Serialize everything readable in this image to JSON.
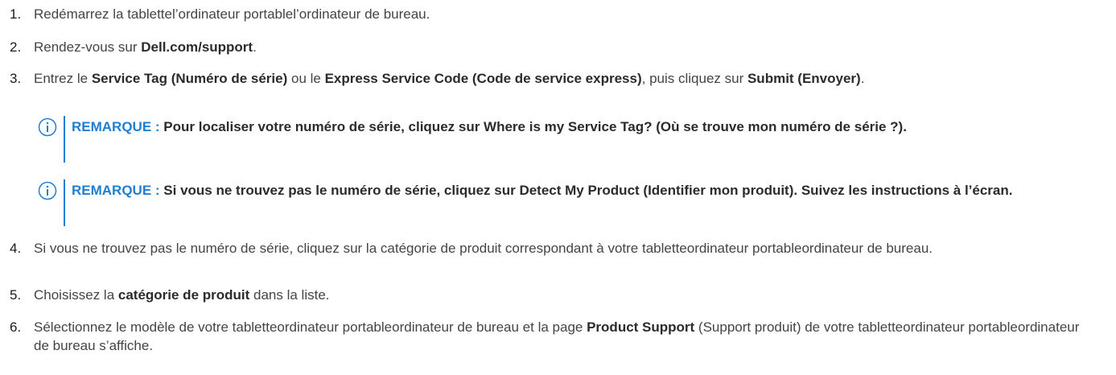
{
  "steps": [
    {
      "num": "1.",
      "segments": [
        {
          "t": "Redémarrez la tablettel’ordinateur portablel’ordinateur de bureau.",
          "b": false
        }
      ]
    },
    {
      "num": "2.",
      "segments": [
        {
          "t": "Rendez-vous sur ",
          "b": false
        },
        {
          "t": "Dell.com/support",
          "b": true
        },
        {
          "t": ".",
          "b": false
        }
      ]
    },
    {
      "num": "3.",
      "segments": [
        {
          "t": "Entrez le ",
          "b": false
        },
        {
          "t": "Service Tag (Numéro de série)",
          "b": true
        },
        {
          "t": " ou le ",
          "b": false
        },
        {
          "t": "Express Service Code (Code de service express)",
          "b": true
        },
        {
          "t": ", puis cliquez sur ",
          "b": false
        },
        {
          "t": "Submit (Envoyer)",
          "b": true
        },
        {
          "t": ".",
          "b": false
        }
      ]
    },
    {
      "num": "4.",
      "segments": [
        {
          "t": "Si vous ne trouvez pas le numéro de série, cliquez sur la catégorie de produit correspondant à votre tabletteordinateur portableordinateur de bureau.",
          "b": false
        }
      ]
    },
    {
      "num": "5.",
      "segments": [
        {
          "t": "Choisissez la ",
          "b": false
        },
        {
          "t": "catégorie de produit",
          "b": true
        },
        {
          "t": " dans la liste.",
          "b": false
        }
      ]
    },
    {
      "num": "6.",
      "segments": [
        {
          "t": "Sélectionnez le modèle de votre tabletteordinateur portableordinateur de bureau et la page ",
          "b": false
        },
        {
          "t": "Product Support",
          "b": true
        },
        {
          "t": " (Support produit) de votre tabletteordinateur portableordinateur de bureau s’affiche.",
          "b": false
        }
      ]
    }
  ],
  "notes": [
    {
      "label": "REMARQUE :",
      "text": "Pour localiser votre numéro de série, cliquez sur Where is my Service Tag? (Où se trouve mon numéro de série ?)."
    },
    {
      "label": "REMARQUE :",
      "text": "Si vous ne trouvez pas le numéro de série, cliquez sur Detect My Product (Identifier mon produit). Suivez les instructions à l’écran."
    }
  ],
  "icons": {
    "note": "info-icon"
  },
  "colors": {
    "accent": "#1f7ed3",
    "text": "#444444"
  }
}
